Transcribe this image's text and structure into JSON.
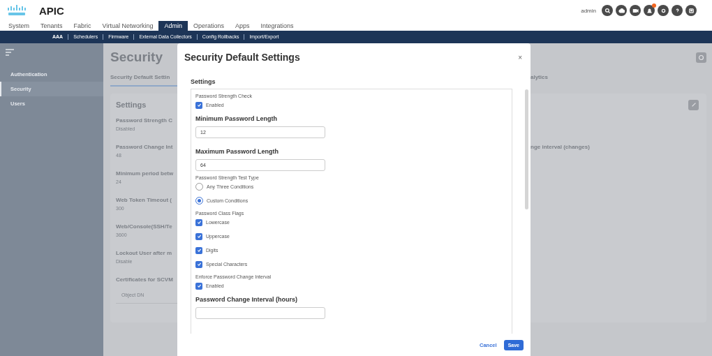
{
  "header": {
    "product": "APIC",
    "user": "admin",
    "notification_badge": true
  },
  "main_tabs": [
    {
      "label": "System",
      "selected": false
    },
    {
      "label": "Tenants",
      "selected": false
    },
    {
      "label": "Fabric",
      "selected": false
    },
    {
      "label": "Virtual Networking",
      "selected": false
    },
    {
      "label": "Admin",
      "selected": true
    },
    {
      "label": "Operations",
      "selected": false
    },
    {
      "label": "Apps",
      "selected": false
    },
    {
      "label": "Integrations",
      "selected": false
    }
  ],
  "sub_tabs": [
    {
      "label": "AAA",
      "selected": true
    },
    {
      "label": "Schedulers",
      "selected": false
    },
    {
      "label": "Firmware",
      "selected": false
    },
    {
      "label": "External Data Collectors",
      "selected": false
    },
    {
      "label": "Config Rollbacks",
      "selected": false
    },
    {
      "label": "Import/Export",
      "selected": false
    }
  ],
  "sidebar": {
    "items": [
      {
        "label": "Authentication",
        "selected": false
      },
      {
        "label": "Security",
        "selected": true
      },
      {
        "label": "Users",
        "selected": false
      }
    ]
  },
  "page": {
    "title": "Security",
    "tabs": [
      {
        "label": "Security Default Settin",
        "selected": true
      },
      {
        "label": "alytics",
        "selected": false
      }
    ],
    "card": {
      "title": "Settings",
      "fields": [
        {
          "label": "Password Strength C",
          "value": "Disabled"
        },
        {
          "label": "Password Change Int",
          "value": "48",
          "column_2_label": "nge interval (changes)"
        },
        {
          "label": "Minimum period betw",
          "value": "24"
        },
        {
          "label": "Web Token Timeout (",
          "value": "300"
        },
        {
          "label": "Web/Console(SSH/Te",
          "value": "3600"
        },
        {
          "label": "Lockout User after m",
          "value": "Disable"
        },
        {
          "label": "Certificates for SCVM"
        }
      ],
      "table": {
        "columns": [
          "Object DN"
        ]
      }
    }
  },
  "dialog": {
    "title": "Security Default Settings",
    "close": "×",
    "section": "Settings",
    "items": [
      {
        "kind": "checkbox",
        "label": "Password Strength Check",
        "options": [
          {
            "label": "Enabled",
            "checked": true
          }
        ]
      },
      {
        "kind": "input",
        "label": "Minimum Password Length",
        "value": "12"
      },
      {
        "kind": "input",
        "label": "Maximum Password Length",
        "value": "64"
      },
      {
        "kind": "radio",
        "label": "Password Strength Test Type",
        "options": [
          {
            "label": "Any Three Conditions",
            "selected": false
          },
          {
            "label": "Custom Conditions",
            "selected": true
          }
        ]
      },
      {
        "kind": "checkbox",
        "label": "Password Class Flags",
        "options": [
          {
            "label": "Lowercase",
            "checked": true
          },
          {
            "label": "Uppercase",
            "checked": true
          },
          {
            "label": "Digits",
            "checked": true
          },
          {
            "label": "Special Characters",
            "checked": true
          }
        ]
      },
      {
        "kind": "checkbox",
        "label": "Enforce Password Change Interval",
        "options": [
          {
            "label": "Enabled",
            "checked": true
          }
        ]
      },
      {
        "kind": "input",
        "label": "Password Change Interval (hours)"
      }
    ],
    "buttons": [
      {
        "label": "Cancel",
        "kind": "link"
      },
      {
        "label": "Save",
        "kind": "primary"
      }
    ]
  }
}
